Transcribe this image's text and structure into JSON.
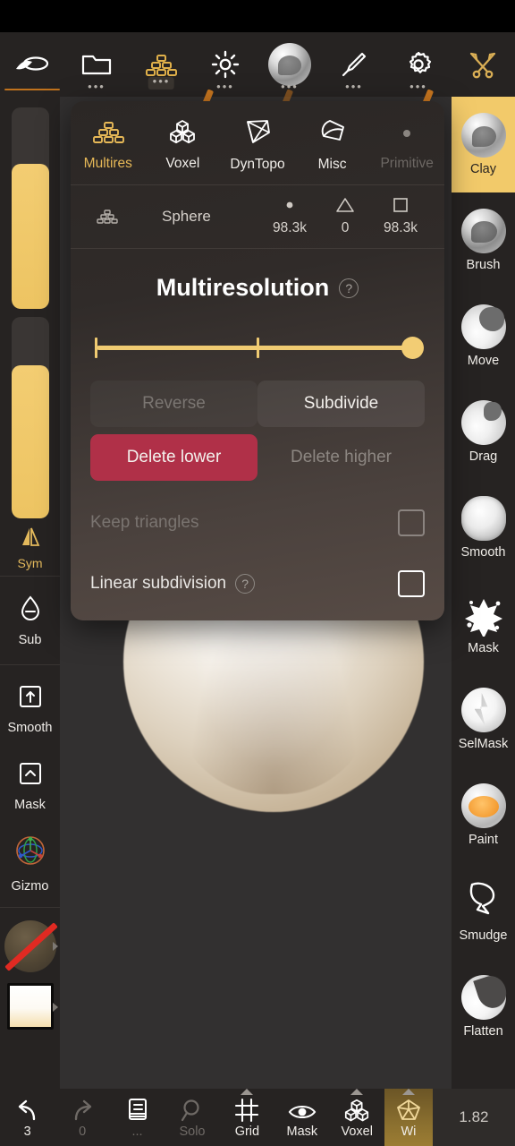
{
  "app": {
    "version": "1.82"
  },
  "topbar": {
    "items": [
      {
        "name": "sculpt-tool",
        "icon": "sculpt-stroke-icon",
        "dots": false,
        "underline": true,
        "boxed": false,
        "accent": true
      },
      {
        "name": "files",
        "icon": "folder-icon",
        "dots": true,
        "underline": false,
        "boxed": false,
        "accent": false
      },
      {
        "name": "topology",
        "icon": "multires-stack-icon",
        "dots": true,
        "underline": false,
        "boxed": true,
        "accent": true
      },
      {
        "name": "lighting",
        "icon": "sun-icon",
        "dots": true,
        "underline": false,
        "boxed": false,
        "accent": false
      },
      {
        "name": "material",
        "icon": "matcap-sphere-icon",
        "dots": true,
        "underline": false,
        "boxed": false,
        "accent": true
      },
      {
        "name": "brush",
        "icon": "paintbrush-icon",
        "dots": true,
        "underline": false,
        "boxed": false,
        "accent": false
      },
      {
        "name": "settings",
        "icon": "gear-icon",
        "dots": true,
        "underline": false,
        "boxed": false,
        "accent": true
      },
      {
        "name": "tools",
        "icon": "wrench-screwdriver-icon",
        "dots": false,
        "underline": false,
        "boxed": false,
        "accent": false
      }
    ]
  },
  "left_sidebar": {
    "sliders": [
      {
        "name": "brush-size-slider",
        "fill_pct": 72
      },
      {
        "name": "brush-intensity-slider",
        "fill_pct": 76
      }
    ],
    "symmetry": {
      "label": "Sym",
      "icon": "symmetry-icon"
    },
    "buttons": [
      {
        "label": "Sub",
        "icon": "droplet-minus-icon"
      },
      {
        "label": "Smooth",
        "icon": "square-up-arrow-icon"
      },
      {
        "label": "Mask",
        "icon": "square-chevron-up-icon"
      },
      {
        "label": "Gizmo",
        "icon": "gizmo-axes-icon"
      }
    ],
    "material_swatch": {
      "name": "material-swatch-disabled",
      "icon": "no-material-icon"
    },
    "color_swatch": {
      "name": "color-swatch"
    }
  },
  "right_sidebar": {
    "brushes": [
      {
        "label": "Clay",
        "icon": "clay-brush-icon",
        "active": true
      },
      {
        "label": "Brush",
        "icon": "standard-brush-icon",
        "active": false
      },
      {
        "label": "Move",
        "icon": "move-brush-icon",
        "active": false
      },
      {
        "label": "Drag",
        "icon": "drag-brush-icon",
        "active": false
      },
      {
        "label": "Smooth",
        "icon": "smooth-brush-icon",
        "active": false
      },
      {
        "label": "Mask",
        "icon": "mask-brush-icon",
        "active": false
      },
      {
        "label": "SelMask",
        "icon": "selmask-brush-icon",
        "active": false
      },
      {
        "label": "Paint",
        "icon": "paint-brush-icon",
        "active": false
      },
      {
        "label": "Smudge",
        "icon": "smudge-brush-icon",
        "active": false
      },
      {
        "label": "Flatten",
        "icon": "flatten-brush-icon",
        "active": false
      }
    ]
  },
  "bottombar": {
    "items": [
      {
        "label": "3",
        "icon": "undo-arrow-icon",
        "dim": false,
        "highlight": false,
        "caret": false
      },
      {
        "label": "0",
        "icon": "redo-arrow-icon",
        "dim": true,
        "highlight": false,
        "caret": false
      },
      {
        "label": "...",
        "icon": "layers-icon",
        "dim": true,
        "highlight": false,
        "caret": false
      },
      {
        "label": "Solo",
        "icon": "magnifier-icon",
        "dim": true,
        "highlight": false,
        "caret": false
      },
      {
        "label": "Grid",
        "icon": "grid-frame-icon",
        "dim": false,
        "highlight": false,
        "caret": true
      },
      {
        "label": "Mask",
        "icon": "eye-icon",
        "dim": false,
        "highlight": false,
        "caret": false
      },
      {
        "label": "Voxel",
        "icon": "voxel-cubes-icon",
        "dim": false,
        "highlight": false,
        "caret": true
      },
      {
        "label": "Wi",
        "icon": "wireframe-icon",
        "dim": false,
        "highlight": true,
        "caret": true
      }
    ]
  },
  "panel": {
    "tabs": [
      {
        "label": "Multires",
        "icon": "multires-stack-icon",
        "active": true,
        "disabled": false
      },
      {
        "label": "Voxel",
        "icon": "voxel-cubes-icon",
        "active": false,
        "disabled": false
      },
      {
        "label": "DynTopo",
        "icon": "gem-icon",
        "active": false,
        "disabled": false
      },
      {
        "label": "Misc",
        "icon": "misc-shape-icon",
        "active": false,
        "disabled": false
      },
      {
        "label": "Primitive",
        "icon": "dot-icon",
        "active": false,
        "disabled": true
      }
    ],
    "mesh": {
      "icon": "multires-stack-small-icon",
      "name": "Sphere",
      "stats": [
        {
          "icon": "vertex-dot-icon",
          "value": "98.3k"
        },
        {
          "icon": "triangle-icon",
          "value": "0"
        },
        {
          "icon": "quad-square-icon",
          "value": "98.3k"
        }
      ]
    },
    "title": "Multiresolution",
    "title_help": "?",
    "slider": {
      "name": "multires-level-slider",
      "ticks": 3,
      "value_pct": 100
    },
    "buttons": [
      {
        "label": "Reverse",
        "style": "ghost"
      },
      {
        "label": "Subdivide",
        "style": "soft"
      },
      {
        "label": "Delete lower",
        "style": "danger"
      },
      {
        "label": "Delete higher",
        "style": "flat"
      }
    ],
    "checkboxes": [
      {
        "label": "Keep triangles",
        "checked": false,
        "disabled": true,
        "help": false
      },
      {
        "label": "Linear subdivision",
        "checked": false,
        "disabled": false,
        "help": true,
        "help_label": "?"
      }
    ]
  },
  "colors": {
    "accent_gold": "#f0cb72",
    "accent_orange": "#c8761f",
    "danger_red": "#b03048",
    "panel_bg": "#2b2725",
    "chrome_bg": "#262322",
    "viewport_bg": "#323030"
  }
}
